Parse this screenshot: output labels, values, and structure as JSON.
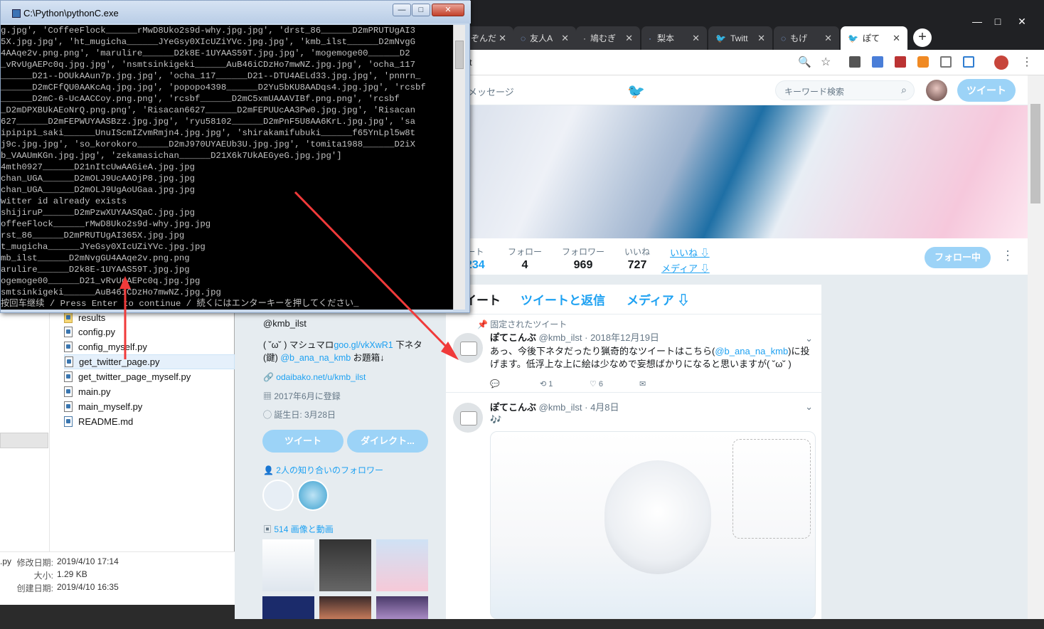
{
  "console": {
    "title": "C:\\Python\\pythonC.exe",
    "lines": [
      "g.jpg', 'CoffeeFlock______rMwD8Uko2s9d-why.jpg.jpg', 'drst_86______D2mPRUTUgAI3",
      "5X.jpg.jpg', 'ht_mugicha______JYeGsy0XIcUZiYVc.jpg.jpg', 'kmb_ilst______D2mNvgG",
      "4AAqe2v.png.png', 'marulire______D2k8E-1UYAAS59T.jpg.jpg', 'mogemoge00______D2",
      "_vRvUgAEPc0q.jpg.jpg', 'nsmtsinkigeki______AuB46iCDzHo7mwNZ.jpg.jpg', 'ocha_117",
      "______D21--DOUkAAun7p.jpg.jpg', 'ocha_117______D21--DTU4AELd33.jpg.jpg', 'pnnrn_",
      "______D2mCFfQU0AAKcAq.jpg.jpg', 'popopo4398______D2Yu5bKU8AADqs4.jpg.jpg', 'rcsbf",
      "______D2mC-6-UcAACCoy.png.png', 'rcsbf______D2mC5xmUAAAVIBf.png.png', 'rcsbf",
      "_D2mDPXBUkAEoNrQ.png.png', 'Risacan6627______D2mFEPUUcAA3Pw0.jpg.jpg', 'Risacan",
      "627______D2mFEPWUYAASBzz.jpg.jpg', 'ryu58102______D2mPnF5U8AA6KrL.jpg.jpg', 'sa",
      "ipipipi_saki______UnuIScmIZvmRmjn4.jpg.jpg', 'shirakamifubuki______f65YnLpl5w8t",
      "j9c.jpg.jpg', 'so_korokoro______D2mJ970UYAEUb3U.jpg.jpg', 'tomita1988______D2iX",
      "b_VAAUmKGn.jpg.jpg', 'zekamasichan______D21X6k7UkAEGyeG.jpg.jpg']",
      "4mth0927______D21nItcUwAAGieA.jpg.jpg",
      "chan_UGA______D2mOLJ9UcAAOjP8.jpg.jpg",
      "chan_UGA______D2mOLJ9UgAoUGaa.jpg.jpg",
      "witter id already exists",
      "shijiruP______D2mPzwXUYAASQaC.jpg.jpg",
      "offeeFlock______rMwD8Uko2s9d-why.jpg.jpg",
      "rst_86______D2mPRUTUgAI365X.jpg.jpg",
      "t_mugicha______JYeGsy0XIcUZiYVc.jpg.jpg",
      "mb_ilst______D2mNvgGU4AAqe2v.png.png",
      "arulire______D2k8E-1UYAAS59T.jpg.jpg",
      "ogemoge00______D21_vRvUgAEPc0q.jpg.jpg",
      "smtsinkigeki______AuB46iCDzHo7mwNZ.jpg.jpg",
      "按回车继续 / Press Enter to continue / 続くにはエンターキーを押してください_"
    ],
    "btn_min": "—",
    "btn_max": "□",
    "btn_close": "✕"
  },
  "explorer": {
    "files": [
      {
        "name": "results",
        "type": "folder"
      },
      {
        "name": "config.py",
        "type": "py"
      },
      {
        "name": "config_myself.py",
        "type": "py"
      },
      {
        "name": "get_twitter_page.py",
        "type": "py"
      },
      {
        "name": "get_twitter_page_myself.py",
        "type": "py"
      },
      {
        "name": "main.py",
        "type": "py"
      },
      {
        "name": "main_myself.py",
        "type": "py"
      },
      {
        "name": "README.md",
        "type": "md"
      }
    ],
    "details": {
      "ext": ".py",
      "modified_label": "修改日期:",
      "modified_value": "2019/4/10 17:14",
      "size_label": "大小:",
      "size_value": "1.29 KB",
      "created_label": "创建日期:",
      "created_value": "2019/4/10 16:35"
    }
  },
  "browser": {
    "tabs": [
      {
        "label": "ぞんだ",
        "active": false
      },
      {
        "label": "友人A",
        "active": false
      },
      {
        "label": "鳩むぎ",
        "active": false
      },
      {
        "label": "梨本",
        "active": false
      },
      {
        "label": "Twitt",
        "active": false
      },
      {
        "label": "もげ",
        "active": false
      },
      {
        "label": "ぽて",
        "active": true
      }
    ],
    "address": "t",
    "window_min": "—",
    "window_max": "□",
    "window_close": "✕"
  },
  "twitter": {
    "nav_messages": "メッセージ",
    "search_placeholder": "キーワード検索",
    "tweet_button": "ツイート",
    "stats": [
      {
        "label": "ート",
        "value": "234"
      },
      {
        "label": "フォロー",
        "value": "4"
      },
      {
        "label": "フォロワー",
        "value": "969"
      },
      {
        "label": "いいね",
        "value": "727"
      }
    ],
    "stat_links": [
      "いいね ⇩",
      "メディア ⇩"
    ],
    "follow_button": "フォロー中",
    "tl_tabs": [
      "イート",
      "ツイートと返信",
      "メディア ⇩"
    ],
    "pinned_label": "固定されたツイート",
    "tweet1": {
      "name": "ぽてこんぶ",
      "handle": "@kmb_ilst",
      "date": "· 2018年12月19日",
      "text_a": "あっ、今後下ネタだったり猟奇的なツイートはこちら(",
      "text_link": "@b_ana_na_kmb",
      "text_b": ")に投げます。低浮上な上に絵は少なめで妄想ばかりになると思いますが( ˘ω˘ )",
      "retweets": "1",
      "likes": "6"
    },
    "tweet2": {
      "name": "ぽてこんぶ",
      "handle": "@kmb_ilst",
      "date": "· 4月8日",
      "text": "🎶"
    },
    "profile": {
      "handle": "@kmb_ilst",
      "bio_a": "( ˘ω˘ ) マシュマロ",
      "bio_link": "goo.gl/vkXwR1",
      "bio_b": " 下ネタ",
      "bio_c": "(鍵) ",
      "bio_link2": "@b_ana_na_kmb",
      "bio_d": " お題箱↓",
      "website": "odaibako.net/u/kmb_ilst",
      "joined": "2017年6月に登録",
      "birthday": "誕生日: 3月28日",
      "tweet_btn": "ツイート",
      "dm_btn": "ダイレクト...",
      "followers_known": "2人の知り合いのフォロワー",
      "media_count": "514 画像と動画"
    }
  },
  "colors": {
    "twitter_blue": "#1da1f2",
    "pale_blue": "#9cd3f7",
    "annotation_red": "#f03a3a"
  }
}
